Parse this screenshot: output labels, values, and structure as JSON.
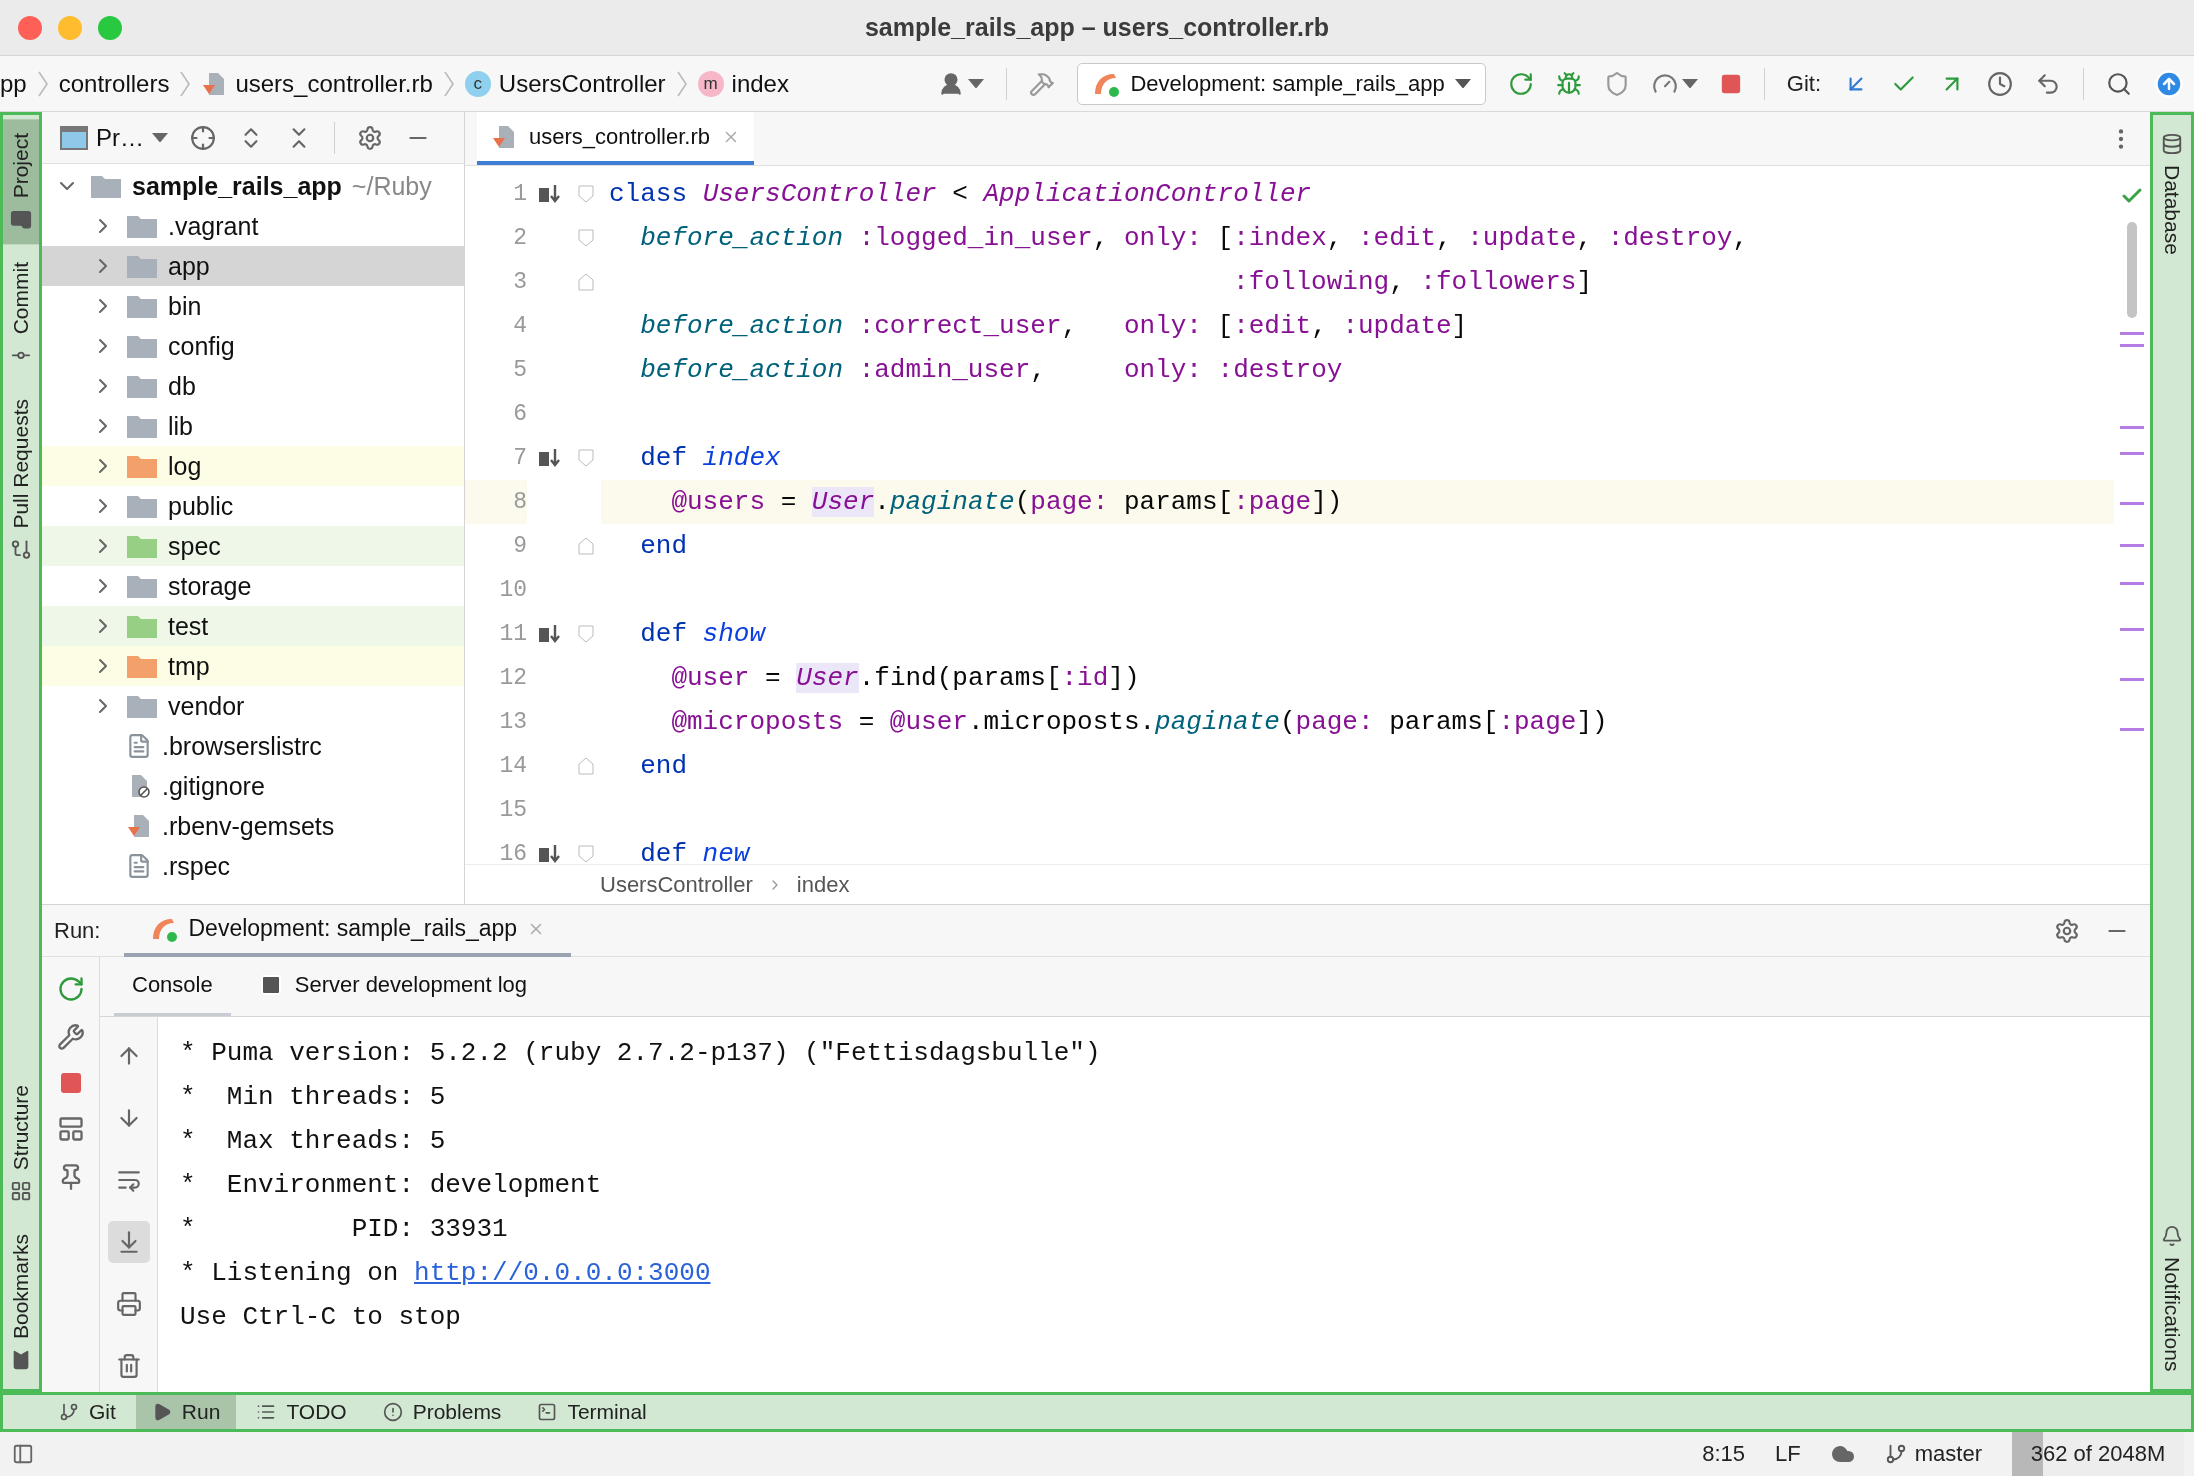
{
  "window": {
    "title": "sample_rails_app – users_controller.rb"
  },
  "navbar": {
    "breadcrumbs": [
      {
        "kind": "directory",
        "label": "pp"
      },
      {
        "kind": "directory",
        "label": "controllers"
      },
      {
        "kind": "ruby-file",
        "label": "users_controller.rb"
      },
      {
        "kind": "class",
        "badge": "c",
        "label": "UsersController"
      },
      {
        "kind": "method",
        "badge": "m",
        "label": "index"
      }
    ],
    "run_config": "Development: sample_rails_app",
    "git_label": "Git:"
  },
  "left_stripe": {
    "top": [
      {
        "kind": "project",
        "label": "Project",
        "selected": true
      },
      {
        "kind": "commit",
        "label": "Commit",
        "selected": false
      },
      {
        "kind": "pull-requests",
        "label": "Pull Requests",
        "selected": false
      }
    ],
    "bottom": [
      {
        "kind": "structure",
        "label": "Structure",
        "selected": false
      },
      {
        "kind": "bookmarks",
        "label": "Bookmarks",
        "selected": false
      }
    ]
  },
  "right_stripe": {
    "top": [
      {
        "kind": "database",
        "label": "Database"
      }
    ],
    "bottom": [
      {
        "kind": "notifications",
        "label": "Notifications"
      }
    ]
  },
  "project": {
    "view_label": "Pr…",
    "tree": {
      "label": "sample_rails_app",
      "path": "~/Ruby",
      "expanded": true,
      "children": [
        {
          "label": ".vagrant",
          "kind": "folder",
          "expanded": false,
          "selected": false
        },
        {
          "label": "app",
          "kind": "folder",
          "expanded": false,
          "selected": true
        },
        {
          "label": "bin",
          "kind": "folder",
          "expanded": false,
          "selected": false
        },
        {
          "label": "config",
          "kind": "folder",
          "expanded": false,
          "selected": false
        },
        {
          "label": "db",
          "kind": "folder",
          "expanded": false,
          "selected": false
        },
        {
          "label": "lib",
          "kind": "folder",
          "expanded": false,
          "selected": false
        },
        {
          "label": "log",
          "kind": "excluded-folder",
          "expanded": false,
          "selected": false
        },
        {
          "label": "public",
          "kind": "folder",
          "expanded": false,
          "selected": false
        },
        {
          "label": "spec",
          "kind": "test-folder",
          "expanded": false,
          "selected": false
        },
        {
          "label": "storage",
          "kind": "folder",
          "expanded": false,
          "selected": false
        },
        {
          "label": "test",
          "kind": "test-folder",
          "expanded": false,
          "selected": false
        },
        {
          "label": "tmp",
          "kind": "excluded-folder",
          "expanded": false,
          "selected": false
        },
        {
          "label": "vendor",
          "kind": "folder",
          "expanded": false,
          "selected": false
        },
        {
          "label": ".browserslistrc",
          "kind": "text-file",
          "selected": false
        },
        {
          "label": ".gitignore",
          "kind": "ignore-file",
          "selected": false
        },
        {
          "label": ".rbenv-gemsets",
          "kind": "ruby-file",
          "selected": false
        },
        {
          "label": ".rspec",
          "kind": "text-file",
          "selected": false
        }
      ]
    }
  },
  "editor": {
    "tabs": [
      {
        "label": "users_controller.rb",
        "selected": true
      }
    ],
    "lines": [
      {
        "number": "1",
        "override": true,
        "fold_start": true,
        "fold_end": false,
        "current": false,
        "tokens": [
          {
            "text": "class ",
            "kind": "kw"
          },
          {
            "text": "UsersController",
            "kind": "const"
          },
          {
            "text": " < ",
            "kind": "plain"
          },
          {
            "text": "ApplicationController",
            "kind": "const"
          }
        ]
      },
      {
        "number": "2",
        "override": false,
        "fold_start": true,
        "fold_end": false,
        "current": false,
        "tokens": [
          {
            "text": "  before_action",
            "kind": "call"
          },
          {
            "text": " :logged_in_user",
            "kind": "sym"
          },
          {
            "text": ", ",
            "kind": "plain"
          },
          {
            "text": "only:",
            "kind": "sym"
          },
          {
            "text": " [",
            "kind": "plain"
          },
          {
            "text": ":index",
            "kind": "sym"
          },
          {
            "text": ", ",
            "kind": "plain"
          },
          {
            "text": ":edit",
            "kind": "sym"
          },
          {
            "text": ", ",
            "kind": "plain"
          },
          {
            "text": ":update",
            "kind": "sym"
          },
          {
            "text": ", ",
            "kind": "plain"
          },
          {
            "text": ":destroy",
            "kind": "sym"
          },
          {
            "text": ",",
            "kind": "plain"
          }
        ]
      },
      {
        "number": "3",
        "override": false,
        "fold_start": false,
        "fold_end": true,
        "current": false,
        "tokens": [
          {
            "text": "                                        :following",
            "kind": "sym"
          },
          {
            "text": ", ",
            "kind": "plain"
          },
          {
            "text": ":followers",
            "kind": "sym"
          },
          {
            "text": "]",
            "kind": "plain"
          }
        ]
      },
      {
        "number": "4",
        "override": false,
        "fold_start": false,
        "fold_end": false,
        "current": false,
        "tokens": [
          {
            "text": "  before_action",
            "kind": "call"
          },
          {
            "text": " :correct_user",
            "kind": "sym"
          },
          {
            "text": ",   ",
            "kind": "plain"
          },
          {
            "text": "only:",
            "kind": "sym"
          },
          {
            "text": " [",
            "kind": "plain"
          },
          {
            "text": ":edit",
            "kind": "sym"
          },
          {
            "text": ", ",
            "kind": "plain"
          },
          {
            "text": ":update",
            "kind": "sym"
          },
          {
            "text": "]",
            "kind": "plain"
          }
        ]
      },
      {
        "number": "5",
        "override": false,
        "fold_start": false,
        "fold_end": false,
        "current": false,
        "tokens": [
          {
            "text": "  before_action",
            "kind": "call"
          },
          {
            "text": " :admin_user",
            "kind": "sym"
          },
          {
            "text": ",     ",
            "kind": "plain"
          },
          {
            "text": "only:",
            "kind": "sym"
          },
          {
            "text": " :destroy",
            "kind": "sym"
          }
        ]
      },
      {
        "number": "6",
        "override": false,
        "fold_start": false,
        "fold_end": false,
        "current": false
      },
      {
        "number": "7",
        "override": true,
        "fold_start": true,
        "fold_end": false,
        "current": false,
        "tokens": [
          {
            "text": "  def",
            "kind": "kw"
          },
          {
            "text": " index",
            "kind": "name"
          }
        ]
      },
      {
        "number": "8",
        "override": false,
        "fold_start": false,
        "fold_end": false,
        "current": true,
        "tokens": [
          {
            "text": "    @users",
            "kind": "ivar"
          },
          {
            "text": " = ",
            "kind": "plain"
          },
          {
            "text": "User",
            "kind": "const-ref"
          },
          {
            "text": ".",
            "kind": "plain"
          },
          {
            "text": "paginate",
            "kind": "call"
          },
          {
            "text": "(",
            "kind": "plain"
          },
          {
            "text": "page:",
            "kind": "sym"
          },
          {
            "text": " params[",
            "kind": "plain"
          },
          {
            "text": ":page",
            "kind": "sym"
          },
          {
            "text": "])",
            "kind": "plain"
          }
        ]
      },
      {
        "number": "9",
        "override": false,
        "fold_start": false,
        "fold_end": true,
        "current": false,
        "tokens": [
          {
            "text": "  end",
            "kind": "kw"
          }
        ]
      },
      {
        "number": "10",
        "override": false,
        "fold_start": false,
        "fold_end": false,
        "current": false
      },
      {
        "number": "11",
        "override": true,
        "fold_start": true,
        "fold_end": false,
        "current": false,
        "tokens": [
          {
            "text": "  def",
            "kind": "kw"
          },
          {
            "text": " show",
            "kind": "name"
          }
        ]
      },
      {
        "number": "12",
        "override": false,
        "fold_start": false,
        "fold_end": false,
        "current": false,
        "tokens": [
          {
            "text": "    @user",
            "kind": "ivar"
          },
          {
            "text": " = ",
            "kind": "plain"
          },
          {
            "text": "User",
            "kind": "const-ref"
          },
          {
            "text": ".find(params[",
            "kind": "plain"
          },
          {
            "text": ":id",
            "kind": "sym"
          },
          {
            "text": "])",
            "kind": "plain"
          }
        ]
      },
      {
        "number": "13",
        "override": false,
        "fold_start": false,
        "fold_end": false,
        "current": false,
        "tokens": [
          {
            "text": "    @microposts",
            "kind": "ivar"
          },
          {
            "text": " = ",
            "kind": "plain"
          },
          {
            "text": "@user",
            "kind": "ivar"
          },
          {
            "text": ".microposts.",
            "kind": "plain"
          },
          {
            "text": "paginate",
            "kind": "call"
          },
          {
            "text": "(",
            "kind": "plain"
          },
          {
            "text": "page:",
            "kind": "sym"
          },
          {
            "text": " params[",
            "kind": "plain"
          },
          {
            "text": ":page",
            "kind": "sym"
          },
          {
            "text": "])",
            "kind": "plain"
          }
        ]
      },
      {
        "number": "14",
        "override": false,
        "fold_start": false,
        "fold_end": true,
        "current": false,
        "tokens": [
          {
            "text": "  end",
            "kind": "kw"
          }
        ]
      },
      {
        "number": "15",
        "override": false,
        "fold_start": false,
        "fold_end": false,
        "current": false
      },
      {
        "number": "16",
        "override": true,
        "fold_start": true,
        "fold_end": false,
        "current": false,
        "tokens": [
          {
            "text": "  def",
            "kind": "kw"
          },
          {
            "text": " new",
            "kind": "name"
          }
        ]
      }
    ],
    "breadcrumbs": [
      "UsersController",
      "index"
    ]
  },
  "run": {
    "label": "Run:",
    "tabs": [
      {
        "label": "Development: sample_rails_app",
        "selected": true
      }
    ],
    "console_tabs": [
      {
        "kind": "console",
        "label": "Console",
        "selected": true
      },
      {
        "kind": "log",
        "label": "Server development log",
        "selected": false
      }
    ],
    "console_tools": [
      {
        "kind": "up",
        "on": false
      },
      {
        "kind": "down",
        "on": false
      },
      {
        "kind": "wrap",
        "on": false
      },
      {
        "kind": "scroll-end",
        "on": true
      },
      {
        "kind": "print",
        "on": false
      },
      {
        "kind": "clear",
        "on": false
      }
    ],
    "output": [
      {
        "text": "* Puma version: 5.2.2 (ruby 2.7.2-p137) (\"Fettisdagsbulle\")"
      },
      {
        "text": "*  Min threads: 5"
      },
      {
        "text": "*  Max threads: 5"
      },
      {
        "text": "*  Environment: development"
      },
      {
        "text": "*          PID: 33931"
      },
      {
        "text": "* Listening on ",
        "link": "http://0.0.0.0:3000"
      },
      {
        "text": "Use Ctrl-C to stop"
      }
    ]
  },
  "tool_windows": [
    {
      "kind": "git",
      "label": "Git",
      "selected": false
    },
    {
      "kind": "run",
      "label": "Run",
      "selected": true
    },
    {
      "kind": "todo",
      "label": "TODO",
      "selected": false
    },
    {
      "kind": "problems",
      "label": "Problems",
      "selected": false
    },
    {
      "kind": "terminal",
      "label": "Terminal",
      "selected": false
    }
  ],
  "status_bar": {
    "position": "8:15",
    "line_ending": "LF",
    "branch": "master",
    "memory": {
      "text": "362 of 2048M",
      "level": 0.18
    }
  }
}
